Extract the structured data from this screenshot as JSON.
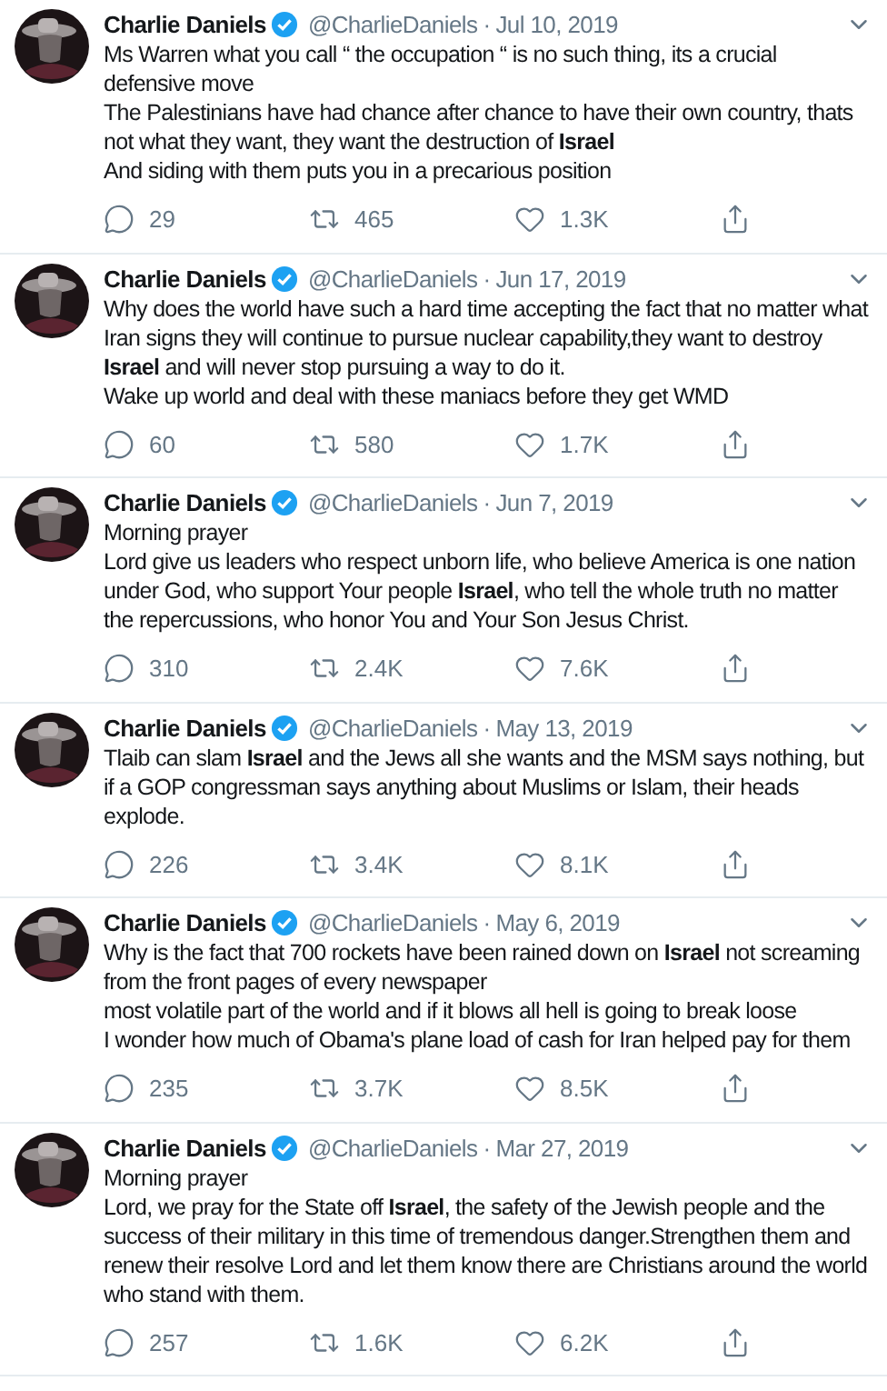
{
  "tweets": [
    {
      "name": "Charlie Daniels",
      "handle": "@CharlieDaniels",
      "sep": "·",
      "date": "Jul 10, 2019",
      "lines": [
        "Ms Warren what you call “ the occupation “ is no such thing, its a crucial defensive move",
        "The Palestinians have had chance after chance to have their own country, thats not what they want, they want the destruction of **Israel**",
        "And siding with them puts you in a precarious position"
      ],
      "replies": "29",
      "retweets": "465",
      "likes": "1.3K"
    },
    {
      "name": "Charlie Daniels",
      "handle": "@CharlieDaniels",
      "sep": "·",
      "date": "Jun 17, 2019",
      "lines": [
        "Why does the world have such a hard time accepting the fact that no matter what Iran signs they will continue to pursue nuclear capability,they want to destroy **Israel** and will never stop pursuing a way to do it.",
        "Wake up world and deal with these maniacs before they get WMD"
      ],
      "replies": "60",
      "retweets": "580",
      "likes": "1.7K"
    },
    {
      "name": "Charlie Daniels",
      "handle": "@CharlieDaniels",
      "sep": "·",
      "date": "Jun 7, 2019",
      "lines": [
        "Morning prayer",
        "Lord give us leaders who respect unborn life, who believe America is one nation under God, who support Your people **Israel**, who tell the whole truth no matter the repercussions, who honor You and Your Son Jesus Christ."
      ],
      "replies": "310",
      "retweets": "2.4K",
      "likes": "7.6K"
    },
    {
      "name": "Charlie Daniels",
      "handle": "@CharlieDaniels",
      "sep": "·",
      "date": "May 13, 2019",
      "lines": [
        "Tlaib can slam **Israel** and the Jews all she wants and the MSM says nothing, but if a GOP congressman says anything about Muslims or Islam, their heads explode."
      ],
      "replies": "226",
      "retweets": "3.4K",
      "likes": "8.1K"
    },
    {
      "name": "Charlie Daniels",
      "handle": "@CharlieDaniels",
      "sep": "·",
      "date": "May 6, 2019",
      "lines": [
        "Why is the fact that 700 rockets have been rained down on **Israel** not screaming from the front pages of every newspaper",
        "most volatile part of the world and if it blows all hell is going to break loose",
        "I wonder how much of Obama's plane load of cash  for Iran helped pay for them"
      ],
      "replies": "235",
      "retweets": "3.7K",
      "likes": "8.5K"
    },
    {
      "name": "Charlie Daniels",
      "handle": "@CharlieDaniels",
      "sep": "·",
      "date": "Mar 27, 2019",
      "lines": [
        "Morning prayer",
        "Lord, we pray for the State off **Israel**, the safety of the Jewish people and the success of their military in this time of tremendous danger.Strengthen them and renew their resolve Lord and let them know there are Christians around the world who stand with them."
      ],
      "replies": "257",
      "retweets": "1.6K",
      "likes": "6.2K"
    }
  ]
}
